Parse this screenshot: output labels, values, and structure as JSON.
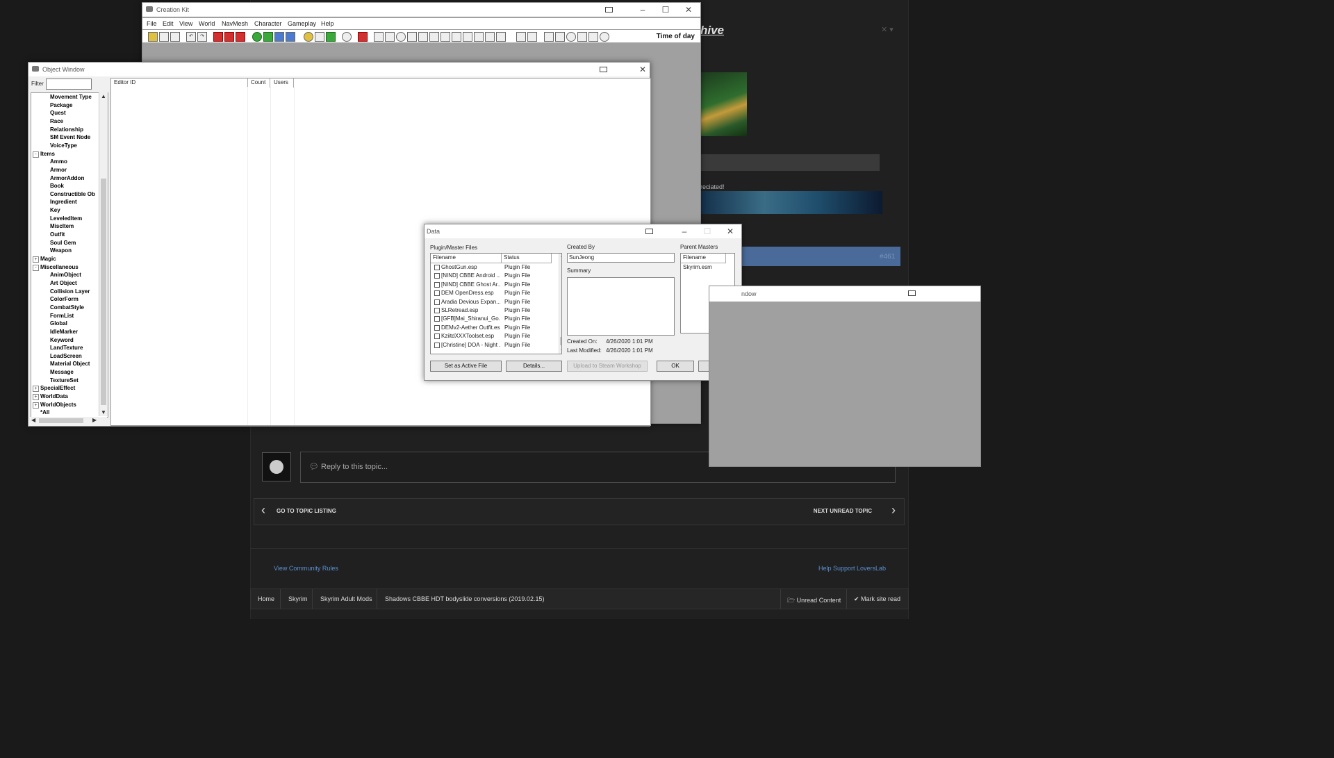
{
  "forum": {
    "title_fragment": "hive",
    "appreciated_fragment": "reciated!",
    "post_number": "#461",
    "reply_placeholder": "Reply to this topic...",
    "go_to_topic_listing": "GO TO TOPIC LISTING",
    "next_unread_topic": "NEXT UNREAD TOPIC",
    "community_rules": "View Community Rules",
    "help_support": "Help Support LoversLab",
    "breadcrumbs": [
      "Home",
      "Skyrim",
      "Skyrim Adult Mods",
      "Shadows CBBE HDT bodyslide conversions (2019.02.15)"
    ],
    "unread_content": "Unread Content",
    "mark_site_read": "Mark site read",
    "colors": {
      "link": "#5b8fcf",
      "post_bar": "#4a6b9a",
      "background": "#1a1a1a"
    }
  },
  "creation_kit": {
    "title": "Creation Kit",
    "menus": [
      "File",
      "Edit",
      "View",
      "World",
      "NavMesh",
      "Character",
      "Gameplay",
      "Help"
    ],
    "time_of_day_label": "Time of day"
  },
  "object_window": {
    "title": "Object Window",
    "filter_label": "Filter",
    "filter_value": "",
    "columns": [
      "Editor ID",
      "Count",
      "Users"
    ],
    "tree": [
      {
        "label": "Movement Type",
        "level": 2
      },
      {
        "label": "Package",
        "level": 2
      },
      {
        "label": "Quest",
        "level": 2
      },
      {
        "label": "Race",
        "level": 2
      },
      {
        "label": "Relationship",
        "level": 2
      },
      {
        "label": "SM Event Node",
        "level": 2
      },
      {
        "label": "VoiceType",
        "level": 2
      },
      {
        "label": "Items",
        "level": 1,
        "expander": "-"
      },
      {
        "label": "Ammo",
        "level": 2
      },
      {
        "label": "Armor",
        "level": 2
      },
      {
        "label": "ArmorAddon",
        "level": 2
      },
      {
        "label": "Book",
        "level": 2
      },
      {
        "label": "Constructible Ob",
        "level": 2
      },
      {
        "label": "Ingredient",
        "level": 2
      },
      {
        "label": "Key",
        "level": 2
      },
      {
        "label": "LeveledItem",
        "level": 2
      },
      {
        "label": "MiscItem",
        "level": 2
      },
      {
        "label": "Outfit",
        "level": 2
      },
      {
        "label": "Soul Gem",
        "level": 2
      },
      {
        "label": "Weapon",
        "level": 2
      },
      {
        "label": "Magic",
        "level": 1,
        "expander": "+"
      },
      {
        "label": "Miscellaneous",
        "level": 1,
        "expander": "-"
      },
      {
        "label": "AnimObject",
        "level": 2
      },
      {
        "label": "Art Object",
        "level": 2
      },
      {
        "label": "Collision Layer",
        "level": 2
      },
      {
        "label": "ColorForm",
        "level": 2
      },
      {
        "label": "CombatStyle",
        "level": 2
      },
      {
        "label": "FormList",
        "level": 2
      },
      {
        "label": "Global",
        "level": 2
      },
      {
        "label": "IdleMarker",
        "level": 2
      },
      {
        "label": "Keyword",
        "level": 2
      },
      {
        "label": "LandTexture",
        "level": 2
      },
      {
        "label": "LoadScreen",
        "level": 2
      },
      {
        "label": "Material Object",
        "level": 2
      },
      {
        "label": "Message",
        "level": 2
      },
      {
        "label": "TextureSet",
        "level": 2
      },
      {
        "label": "SpecialEffect",
        "level": 1,
        "expander": "+"
      },
      {
        "label": "WorldData",
        "level": 1,
        "expander": "+"
      },
      {
        "label": "WorldObjects",
        "level": 1,
        "expander": "+"
      },
      {
        "label": "*All",
        "level": 1
      }
    ]
  },
  "data_dialog": {
    "title": "Data",
    "plugin_master_label": "Plugin/Master Files",
    "filename_header": "Filename",
    "status_header": "Status",
    "files": [
      {
        "name": "GhostGun.esp",
        "status": "Plugin File"
      },
      {
        "name": "[NIND] CBBE Android ...",
        "status": "Plugin File"
      },
      {
        "name": "[NIND] CBBE Ghost Ar...",
        "status": "Plugin File"
      },
      {
        "name": "DEM OpenDress.esp",
        "status": "Plugin File"
      },
      {
        "name": "Aradia Devious Expan...",
        "status": "Plugin File"
      },
      {
        "name": "SLRetread.esp",
        "status": "Plugin File"
      },
      {
        "name": "[GFB]Mai_Shiranui_Go...",
        "status": "Plugin File"
      },
      {
        "name": "DEMv2-Aether Outfit.esp",
        "status": "Plugin File"
      },
      {
        "name": "KziitdXXXToolset.esp",
        "status": "Plugin File"
      },
      {
        "name": "[Christine] DOA - Night ...",
        "status": "Plugin File"
      }
    ],
    "created_by_label": "Created By",
    "created_by_value": "SunJeong",
    "summary_label": "Summary",
    "summary_value": "",
    "created_on_label": "Created On:",
    "created_on_value": "4/26/2020  1:01 PM",
    "last_modified_label": "Last Modified:",
    "last_modified_value": "4/26/2020  1:01 PM",
    "parent_masters_label": "Parent Masters",
    "parent_filename_header": "Filename",
    "parent_masters": [
      "Skyrim.esm"
    ],
    "buttons": {
      "set_active": "Set as Active File",
      "details": "Details...",
      "upload": "Upload to Steam Workshop",
      "ok": "OK",
      "cancel": "Cancel"
    }
  },
  "ghost_window": {
    "title_fragment": "ndow"
  }
}
